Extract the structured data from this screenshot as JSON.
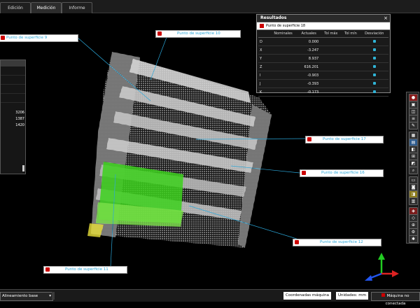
{
  "tabs": [
    {
      "label": "Edición"
    },
    {
      "label": "Medición"
    },
    {
      "label": "Informe"
    }
  ],
  "left_panel": {
    "values": [
      "3206",
      "1387",
      "1420"
    ]
  },
  "callouts": [
    {
      "label": "Punto de superficie 9"
    },
    {
      "label": "Punto de superficie 10"
    },
    {
      "label": "Punto de superficie 17"
    },
    {
      "label": "Punto de superficie 16"
    },
    {
      "label": "Punto de superficie 12"
    },
    {
      "label": "Punto de superficie 11"
    }
  ],
  "results": {
    "title": "Resultados",
    "feature": "Punto de superficie 18",
    "columns": [
      "Nominales",
      "Actuales",
      "Tol máx",
      "Tol mín",
      "Desviación"
    ],
    "rows": [
      {
        "axis": "D",
        "actual": "0.000"
      },
      {
        "axis": "X",
        "actual": "-3.247"
      },
      {
        "axis": "Y",
        "actual": "8.937"
      },
      {
        "axis": "Z",
        "actual": "616.201"
      },
      {
        "axis": "I",
        "actual": "-0.903"
      },
      {
        "axis": "J",
        "actual": "-0.393"
      },
      {
        "axis": "K",
        "actual": "-0.173"
      }
    ]
  },
  "toolbar_icons": [
    "record-icon",
    "cube-icon",
    "box-icon",
    "layers-icon",
    "edit-icon",
    "grid-icon",
    "color-map-icon",
    "section-icon",
    "measure-icon",
    "probe-icon",
    "zoom-icon",
    "image-icon",
    "camera-icon",
    "compare-icon",
    "gradient-icon",
    "palette-icon",
    "model-icon",
    "alignment-icon",
    "tool-icon",
    "settings-icon",
    "gear-icon"
  ],
  "status_bar": {
    "alignment": "Alineamiento base",
    "coords": "Coordenadas máquina",
    "units": "Unidades: mm",
    "machine": "Máquina no conectada"
  },
  "colors": {
    "accent": "#2aa6d8",
    "green": "#3cd11c"
  }
}
